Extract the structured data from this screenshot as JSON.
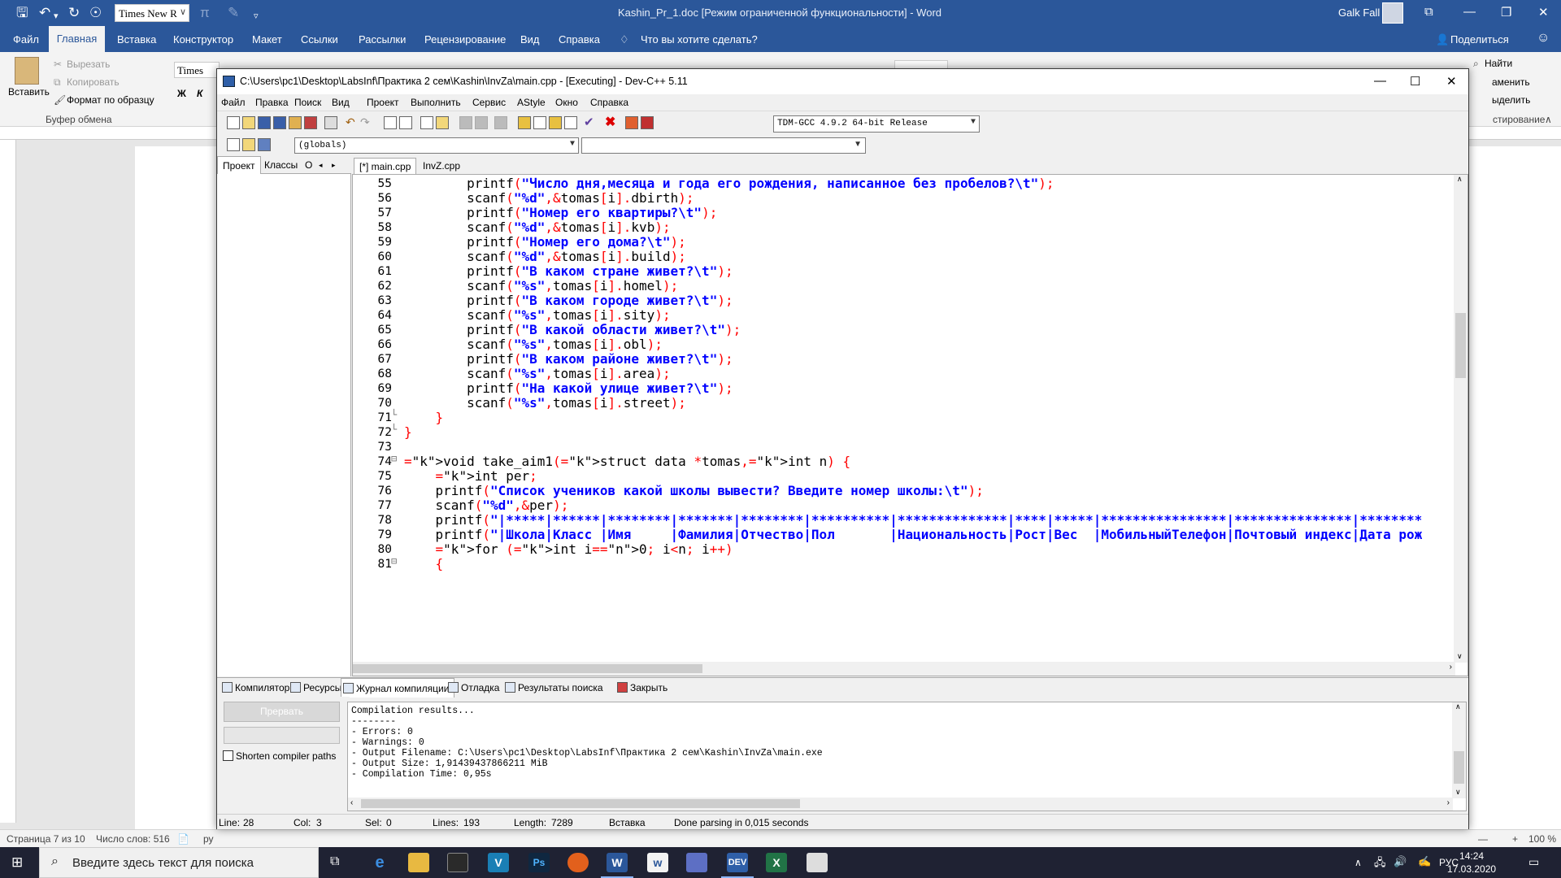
{
  "word": {
    "quick_access": {
      "save_icon": "save-icon",
      "undo_icon": "undo-icon",
      "redo_icon": "redo-icon"
    },
    "font_name": "Times New R",
    "title": "Kashin_Pr_1.doc [Режим ограниченной функциональности]  -  Word",
    "user": "Galk Fall",
    "menu": [
      "Файл",
      "Главная",
      "Вставка",
      "Конструктор",
      "Макет",
      "Ссылки",
      "Рассылки",
      "Рецензирование",
      "Вид",
      "Справка"
    ],
    "tell_me": "Что вы хотите сделать?",
    "share": "Поделиться",
    "ribbon": {
      "paste": "Вставить",
      "cut": "Вырезать",
      "copy": "Копировать",
      "format_painter": "Формат по образцу",
      "clipboard_group": "Буфер обмена",
      "font_short": "Times Ne",
      "bold": "Ж",
      "italic": "К",
      "find": "Найти",
      "replace": "аменить",
      "select": "ыделить",
      "editing_group": "стирование"
    },
    "status": {
      "page": "Страница 7 из 10",
      "words": "Число слов: 516",
      "lang": "ру",
      "zoom": "100 %"
    }
  },
  "taskbar": {
    "search_placeholder": "Введите здесь текст для поиска",
    "lang": "РУС",
    "time": "14:24",
    "date": "17.03.2020"
  },
  "devcpp": {
    "title": "C:\\Users\\pc1\\Desktop\\LabsInf\\Практика 2 сем\\Kashin\\InvZa\\main.cpp - [Executing] - Dev-C++ 5.11",
    "menu": [
      "Файл",
      "Правка",
      "Поиск",
      "Вид",
      "Проект",
      "Выполнить",
      "Сервис",
      "AStyle",
      "Окно",
      "Справка"
    ],
    "compiler": "TDM-GCC 4.9.2 64-bit Release",
    "globals": "(globals)",
    "left_tabs": [
      "Проект",
      "Классы",
      "О"
    ],
    "file_tabs": [
      "[*] main.cpp",
      "InvZ.cpp"
    ],
    "line_numbers": [
      "55",
      "56",
      "57",
      "58",
      "59",
      "60",
      "61",
      "62",
      "63",
      "64",
      "65",
      "66",
      "67",
      "68",
      "69",
      "70",
      "71",
      "72",
      "73",
      "74",
      "75",
      "76",
      "77",
      "78",
      "79",
      "80",
      "81"
    ],
    "code": [
      "        printf(\"Число дня,месяца и года его рождения, написанное без пробелов?\\t\");",
      "        scanf(\"%d\",&tomas[i].dbirth);",
      "        printf(\"Номер его квартиры?\\t\");",
      "        scanf(\"%d\",&tomas[i].kvb);",
      "        printf(\"Номер его дома?\\t\");",
      "        scanf(\"%d\",&tomas[i].build);",
      "        printf(\"В каком стране живет?\\t\");",
      "        scanf(\"%s\",tomas[i].homel);",
      "        printf(\"В каком городе живет?\\t\");",
      "        scanf(\"%s\",tomas[i].sity);",
      "        printf(\"В какой области живет?\\t\");",
      "        scanf(\"%s\",tomas[i].obl);",
      "        printf(\"В каком районе живет?\\t\");",
      "        scanf(\"%s\",tomas[i].area);",
      "        printf(\"На какой улице живет?\\t\");",
      "        scanf(\"%s\",tomas[i].street);",
      "    }",
      "}",
      "",
      "void take_aim1(struct data *tomas,int n) {",
      "    int per;",
      "    printf(\"Список учеников какой школы вывести? Введите номер школы:\\t\");",
      "    scanf(\"%d\",&per);",
      "    printf(\"|*****|******|********|*******|********|**********|**************|****|*****|****************|***************|********",
      "    printf(\"|Школа|Класс |Имя     |Фамилия|Отчество|Пол       |Национальность|Рост|Вес  |МобильныйТелефон|Почтовый индекс|Дата рож",
      "    for (int i=0; i<n; i++)",
      "    {"
    ],
    "bottom_tabs": [
      "Компилятор",
      "Ресурсы",
      "Журнал компиляции",
      "Отладка",
      "Результаты поиска",
      "Закрыть"
    ],
    "stop_button": "Прервать",
    "shorten_label": "Shorten compiler paths",
    "log": [
      "Compilation results...",
      "--------",
      "- Errors: 0",
      "- Warnings: 0",
      "- Output Filename: C:\\Users\\pc1\\Desktop\\LabsInf\\Практика 2 сем\\Kashin\\InvZa\\main.exe",
      "- Output Size: 1,91439437866211 MiB",
      "- Compilation Time: 0,95s"
    ],
    "status": {
      "line_label": "Line:",
      "line": "28",
      "col_label": "Col:",
      "col": "3",
      "sel_label": "Sel:",
      "sel": "0",
      "lines_label": "Lines:",
      "lines": "193",
      "length_label": "Length:",
      "length": "7289",
      "mode": "Вставка",
      "parse": "Done parsing in 0,015 seconds"
    }
  }
}
